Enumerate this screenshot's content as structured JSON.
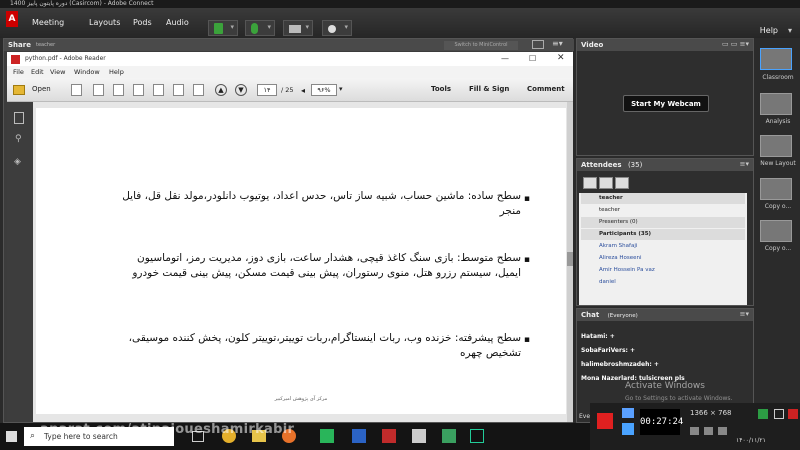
{
  "window": {
    "title": "دوره پایتون پاییز 1400 (Casircom) - Adobe Connect"
  },
  "menu": {
    "items": [
      "Meeting",
      "Layouts",
      "Pods",
      "Audio"
    ],
    "help": "Help"
  },
  "share": {
    "pod_title": "Share",
    "presenter": "teacher",
    "minicontrol": "Switch to MiniControl"
  },
  "reader": {
    "title": "python.pdf - Adobe Reader",
    "menu": [
      "File",
      "Edit",
      "View",
      "Window",
      "Help"
    ],
    "open_label": "Open",
    "page_current": "۱۴",
    "page_total": "/ 25",
    "zoom": "۹۶%",
    "tools": "Tools",
    "fill_sign": "Fill & Sign",
    "comment": "Comment"
  },
  "document": {
    "p1_line1": "سطح ساده: ماشین حساب، شبیه ساز تاس، حدس اعداد، یوتیوب دانلودر،مولد نقل قل، فایل",
    "p1_line2": "منجر",
    "p2_line1": "سطح متوسط: بازی سنگ کاغذ قیچی، هشدار ساعت، بازی دوز، مدیریت رمز، اتوماسیون",
    "p2_line2": "ایمیل، سیستم رزرو هتل، منوی رستوران، پیش بینی قیمت مسکن، پیش بینی قیمت خودرو",
    "p3_line1": "سطح پیشرفته: خزنده وب، ربات اینستاگرام،ربات توییتر،توییتر کلون، پخش کننده موسیقی،",
    "p3_line2": "تشخیص چهره",
    "footer": "مرکز آی پژوهش امیرکبیر"
  },
  "video": {
    "title": "Video",
    "webcam_button": "Start My Webcam"
  },
  "attendees": {
    "title": "Attendees",
    "count": "(35)",
    "hosts_group": "teacher",
    "host_name": "teacher",
    "presenters_group": "Presenters (0)",
    "participants_group": "Participants (35)",
    "participants": [
      "Akram Shafaji",
      "Alireza Hoseeni",
      "Amir Hossein Pa vaz",
      "daniel"
    ]
  },
  "chat": {
    "title": "Chat",
    "scope": "(Everyone)",
    "lines": [
      "Hatami: +",
      "SobaFariVers: +",
      "halimebroshmzadeh: +",
      "Mona Nazerlard: tulsicreen pls"
    ],
    "activate": "Activate Windows",
    "activate_sub": "Go to Settings to activate Windows.",
    "footer_label": "Eve"
  },
  "layouts": {
    "items": [
      "Classroom",
      "Analysis",
      "New Layout",
      "Copy o...",
      "Copy o..."
    ]
  },
  "taskbar": {
    "search_placeholder": "Type here to search",
    "watermark": "aparat.com/atipajoueshamirkabir"
  },
  "recorder": {
    "timer": "00:27:24",
    "resolution": "1366 × 768",
    "date": "۱۴۰۰/۱۱/۲۱"
  },
  "colors": {
    "accent_red": "#e02020",
    "timer_bg": "#000000",
    "webcam_btn": "#111111"
  }
}
